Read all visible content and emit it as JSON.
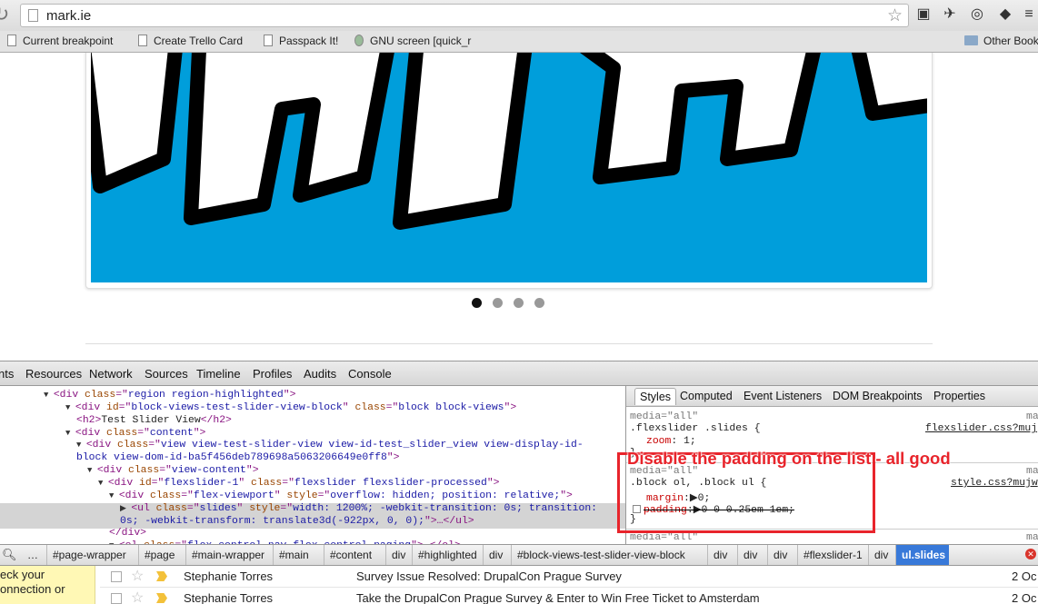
{
  "browser": {
    "url": "mark.ie",
    "bookmarks": [
      "Current breakpoint",
      "Create Trello Card",
      "Passpack It!",
      "GNU screen [quick_r",
      "Other Book"
    ]
  },
  "slider": {
    "dot_count": 4,
    "active_dot": 0
  },
  "devtools": {
    "tabs": [
      "nts",
      "Resources",
      "Network",
      "Sources",
      "Timeline",
      "Profiles",
      "Audits",
      "Console"
    ],
    "elements": [
      {
        "indent": 4,
        "tri": "▼",
        "parts": [
          [
            "tag",
            "<div "
          ],
          [
            "an",
            "class"
          ],
          [
            "tag",
            "=\""
          ],
          [
            "av",
            "region region-highlighted"
          ],
          [
            "tag",
            "\">"
          ]
        ]
      },
      {
        "indent": 6,
        "tri": "▼",
        "parts": [
          [
            "tag",
            "<div "
          ],
          [
            "an",
            "id"
          ],
          [
            "tag",
            "=\""
          ],
          [
            "av",
            "block-views-test-slider-view-block"
          ],
          [
            "tag",
            "\" "
          ],
          [
            "an",
            "class"
          ],
          [
            "tag",
            "=\""
          ],
          [
            "av",
            "block block-views"
          ],
          [
            "tag",
            "\">"
          ]
        ]
      },
      {
        "indent": 7,
        "tri": "",
        "parts": [
          [
            "tag",
            "<h2>"
          ],
          [
            "tx",
            "Test Slider View"
          ],
          [
            "tag",
            "</h2>"
          ]
        ]
      },
      {
        "indent": 6,
        "tri": "▼",
        "parts": [
          [
            "tag",
            "<div "
          ],
          [
            "an",
            "class"
          ],
          [
            "tag",
            "=\""
          ],
          [
            "av",
            "content"
          ],
          [
            "tag",
            "\">"
          ]
        ]
      },
      {
        "indent": 7,
        "tri": "▼",
        "parts": [
          [
            "tag",
            "<div "
          ],
          [
            "an",
            "class"
          ],
          [
            "tag",
            "=\""
          ],
          [
            "av",
            "view view-test-slider-view view-id-test_slider_view view-display-id-"
          ]
        ]
      },
      {
        "indent": 7,
        "tri": "",
        "cont": true,
        "parts": [
          [
            "av",
            "block view-dom-id-ba5f456deb789698a5063206649e0ff8"
          ],
          [
            "tag",
            "\">"
          ]
        ]
      },
      {
        "indent": 8,
        "tri": "▼",
        "parts": [
          [
            "tag",
            "<div "
          ],
          [
            "an",
            "class"
          ],
          [
            "tag",
            "=\""
          ],
          [
            "av",
            "view-content"
          ],
          [
            "tag",
            "\">"
          ]
        ]
      },
      {
        "indent": 9,
        "tri": "▼",
        "parts": [
          [
            "tag",
            "<div "
          ],
          [
            "an",
            "id"
          ],
          [
            "tag",
            "=\""
          ],
          [
            "av",
            "flexslider-1"
          ],
          [
            "tag",
            "\" "
          ],
          [
            "an",
            "class"
          ],
          [
            "tag",
            "=\""
          ],
          [
            "av",
            "flexslider flexslider-processed"
          ],
          [
            "tag",
            "\">"
          ]
        ]
      },
      {
        "indent": 10,
        "tri": "▼",
        "parts": [
          [
            "tag",
            "<div "
          ],
          [
            "an",
            "class"
          ],
          [
            "tag",
            "=\""
          ],
          [
            "av",
            "flex-viewport"
          ],
          [
            "tag",
            "\" "
          ],
          [
            "an",
            "style"
          ],
          [
            "tag",
            "=\""
          ],
          [
            "av",
            "overflow: hidden; position: relative;"
          ],
          [
            "tag",
            "\">"
          ]
        ]
      },
      {
        "indent": 11,
        "tri": "▶",
        "sel": true,
        "parts": [
          [
            "tag",
            "<ul "
          ],
          [
            "an",
            "class"
          ],
          [
            "tag",
            "=\""
          ],
          [
            "av",
            "slides"
          ],
          [
            "tag",
            "\" "
          ],
          [
            "an",
            "style"
          ],
          [
            "tag",
            "=\""
          ],
          [
            "av",
            "width: 1200%; -webkit-transition: 0s; transition:"
          ]
        ]
      },
      {
        "indent": 11,
        "tri": "",
        "sel": true,
        "cont": true,
        "parts": [
          [
            "av",
            "0s; -webkit-transform: translate3d(-922px, 0, 0);"
          ],
          [
            "tag",
            "\">…</ul>"
          ]
        ]
      },
      {
        "indent": 10,
        "tri": "",
        "parts": [
          [
            "tag",
            "</div>"
          ]
        ]
      },
      {
        "indent": 10,
        "tri": "▼",
        "parts": [
          [
            "tag",
            "<ol "
          ],
          [
            "an",
            "class"
          ],
          [
            "tag",
            "=\""
          ],
          [
            "av",
            "flex-control-nav flex-control-paging"
          ],
          [
            "tag",
            "\">…</ol>"
          ]
        ]
      }
    ],
    "styles_tabs": [
      "Styles",
      "Computed",
      "Event Listeners",
      "DOM Breakpoints",
      "Properties"
    ],
    "rules": {
      "r1_media": "media=\"all\"",
      "r1_selector": ".flexslider .slides {",
      "r1_source": "flexslider.css?muj",
      "r1_prop": "zoom",
      "r1_value": "1;",
      "r1_close": "}",
      "r2_media": "media=\"all\"",
      "r2_media_right": "ma",
      "r2_selector": ".block ol, .block ul {",
      "r2_source": "style.css?mujw",
      "r2_prop1": "margin",
      "r2_val1": "0;",
      "r2_prop2": "padding",
      "r2_val2": "0 0 0.25em 1em;",
      "r2_close": "}",
      "r3_media": "media=\"all\"",
      "r3_media_right": "ma",
      "r1_media_right": "ma"
    },
    "annotation": "Disable the padding on the list - all good",
    "breadcrumbs": [
      "…",
      "#page-wrapper",
      "#page",
      "#main-wrapper",
      "#main",
      "#content",
      "div",
      "#highlighted",
      "div",
      "#block-views-test-slider-view-block",
      "div",
      "div",
      "div",
      "#flexslider-1",
      "div",
      "ul.slides"
    ]
  },
  "gmail": {
    "notice_lines": [
      "eck your",
      "onnection or"
    ],
    "rows": [
      {
        "sender": "Stephanie Torres",
        "subject": "Survey Issue Resolved: DrupalCon Prague Survey",
        "date": "2 Oc"
      },
      {
        "sender": "Stephanie Torres",
        "subject": "Take the DrupalCon Prague Survey & Enter to Win Free Ticket to Amsterdam",
        "date": "2 Oc"
      }
    ]
  }
}
